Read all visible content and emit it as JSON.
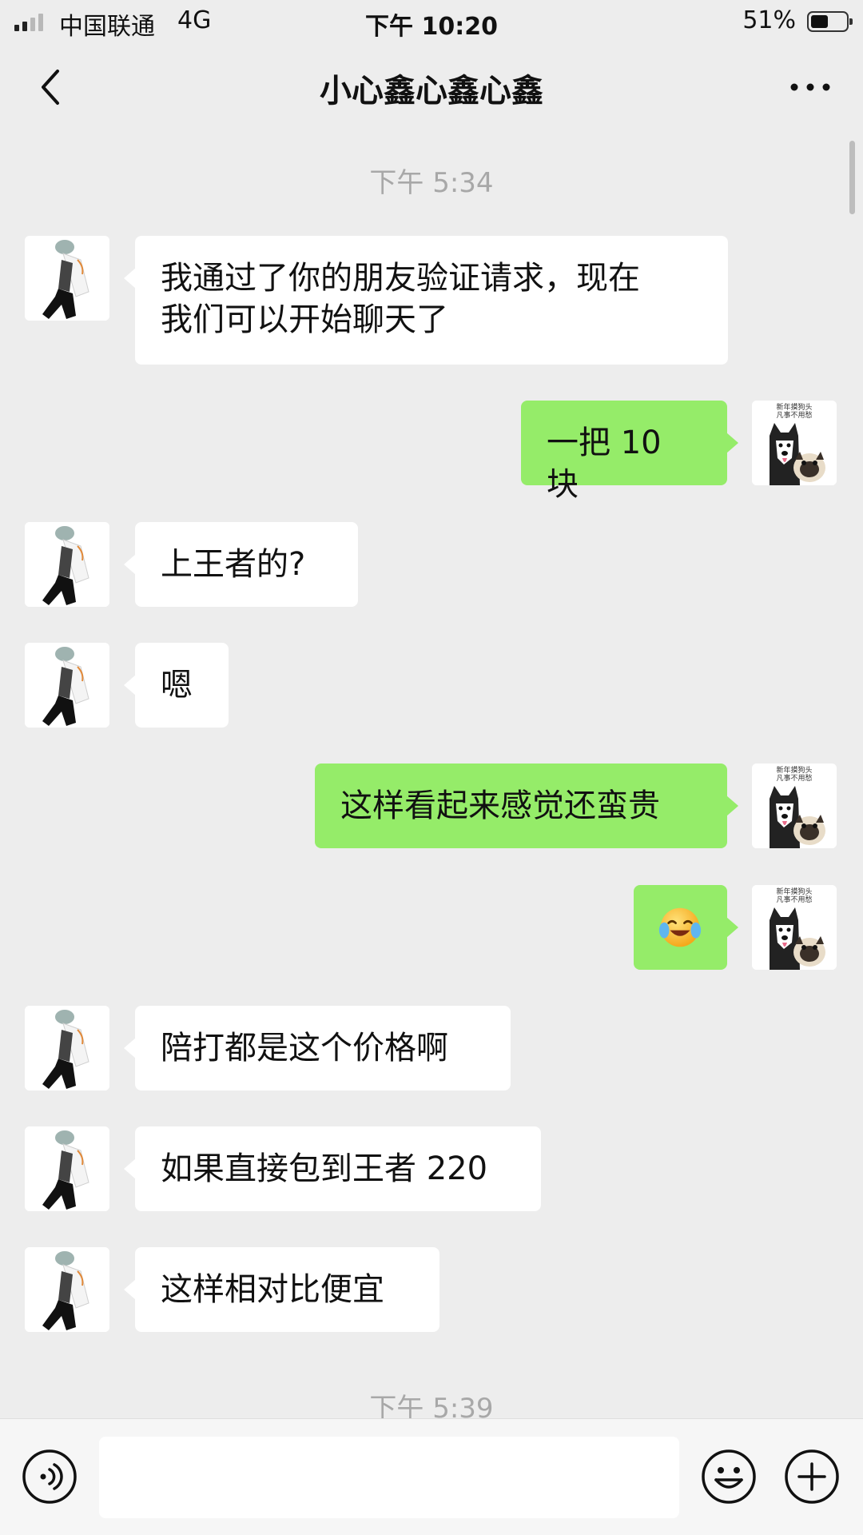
{
  "status_bar": {
    "carrier": "中国联通",
    "network": "4G",
    "time": "下午 10:20",
    "battery_percent_label": "51%",
    "battery_level": 0.51,
    "signal_bars_filled": 2
  },
  "header": {
    "title": "小心鑫心鑫心鑫",
    "back_icon": "chevron-left-icon",
    "more_icon": "more-dots-icon"
  },
  "chat": {
    "time_labels": [
      "下午 5:34",
      "下午 5:39"
    ],
    "messages": [
      {
        "side": "left",
        "text": "我通过了你的朋友验证请求，现在\n我们可以开始聊天了"
      },
      {
        "side": "right",
        "text": "一把 10 块"
      },
      {
        "side": "left",
        "text": "上王者的?"
      },
      {
        "side": "left",
        "text": "嗯"
      },
      {
        "side": "right",
        "text": "这样看起来感觉还蛮贵"
      },
      {
        "side": "right",
        "text": "",
        "emoji": "crying-laughing-emoji"
      },
      {
        "side": "left",
        "text": "陪打都是这个价格啊"
      },
      {
        "side": "left",
        "text": "如果直接包到王者 220"
      },
      {
        "side": "left",
        "text": "这样相对比便宜"
      }
    ],
    "avatar_right_caption": "新年摸狗头 凡事不用愁",
    "colors": {
      "background": "#ededed",
      "incoming_bubble": "#ffffff",
      "outgoing_bubble": "#95ec69"
    }
  },
  "input_bar": {
    "voice_icon": "voice-icon",
    "input_value": "",
    "emoji_icon": "emoji-icon",
    "plus_icon": "plus-icon"
  }
}
